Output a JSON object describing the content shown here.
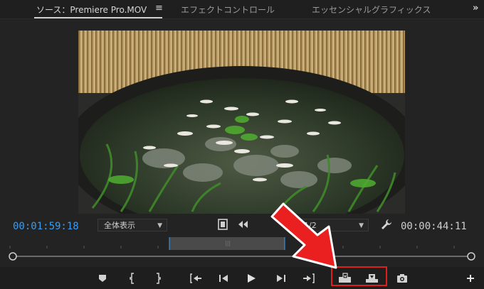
{
  "tabs": [
    {
      "label": "ソース：Premiere Pro.MOV",
      "active": true
    },
    {
      "label": "エフェクトコントロール",
      "active": false
    },
    {
      "label": "エッセンシャルグラフィックス",
      "active": false
    }
  ],
  "icons": {
    "tab_menu": "≡",
    "tab_overflow": "»"
  },
  "monitor": {
    "timecode_current": "00:01:59:18",
    "timecode_duration": "00:00:44:11",
    "fit_dropdown": "全体表示",
    "resolution_dropdown": "1/2"
  },
  "playback_buttons": [
    {
      "name": "add-marker-button",
      "icon": "marker-icon"
    },
    {
      "name": "mark-in-button",
      "icon": "mark-in-icon"
    },
    {
      "name": "mark-out-button",
      "icon": "mark-out-icon"
    },
    {
      "name": "go-to-in-button",
      "icon": "go-to-in-icon"
    },
    {
      "name": "step-back-button",
      "icon": "step-back-icon"
    },
    {
      "name": "play-button",
      "icon": "play-icon"
    },
    {
      "name": "step-forward-button",
      "icon": "step-forward-icon"
    },
    {
      "name": "go-to-out-button",
      "icon": "go-to-out-icon"
    },
    {
      "name": "insert-button",
      "icon": "insert-icon"
    },
    {
      "name": "overwrite-button",
      "icon": "overwrite-icon"
    },
    {
      "name": "export-frame-button",
      "icon": "camera-icon"
    },
    {
      "name": "add-button",
      "icon": "plus-icon"
    }
  ],
  "colors": {
    "accent_timecode": "#3b9cf2",
    "highlight_box": "#e01e1e",
    "arrow": "#ea2020"
  }
}
